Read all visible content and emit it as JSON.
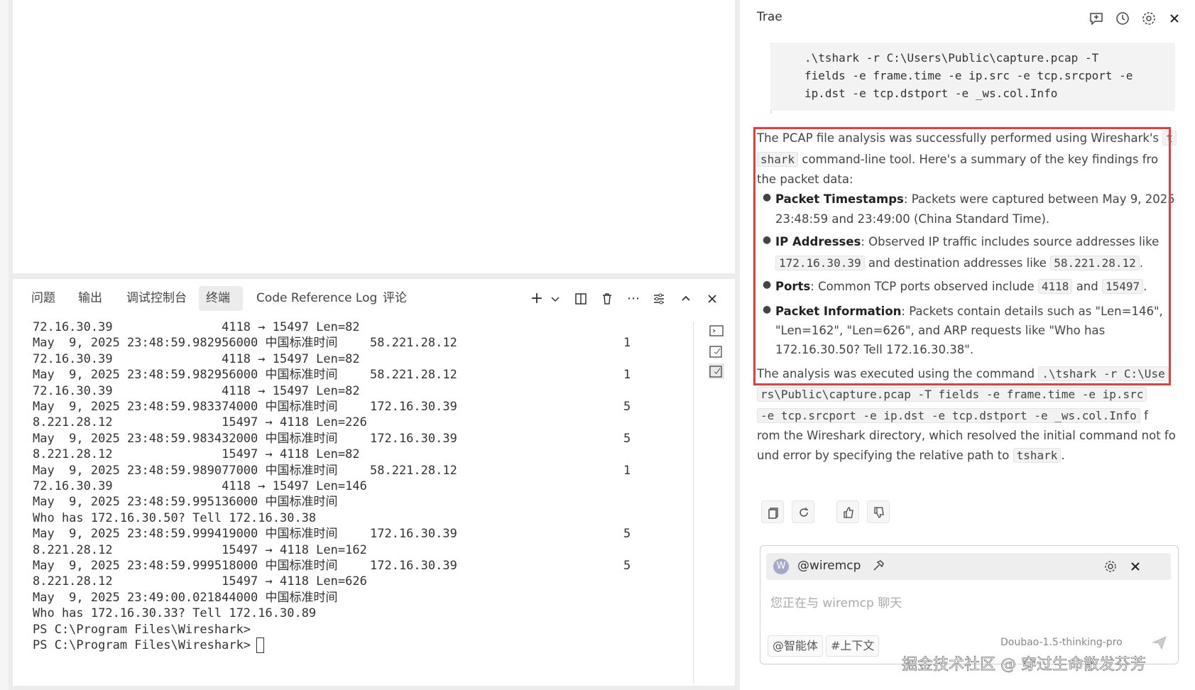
{
  "panel": {
    "tabs": [
      {
        "label": "问题"
      },
      {
        "label": "输出"
      },
      {
        "label": "调试控制台"
      },
      {
        "label": "终端"
      },
      {
        "label": "Code Reference Log"
      },
      {
        "label": "评论"
      }
    ]
  },
  "terminal": {
    "lines": [
      {
        "left": "72.16.30.39               4118 → 15497 Len=82",
        "right": "",
        "n": ""
      },
      {
        "left": "May  9, 2025 23:48:59.982956000 中国标准时间",
        "right": "58.221.28.12",
        "n": "1"
      },
      {
        "left": "72.16.30.39               4118 → 15497 Len=82",
        "right": "",
        "n": ""
      },
      {
        "left": "May  9, 2025 23:48:59.982956000 中国标准时间",
        "right": "58.221.28.12",
        "n": "1"
      },
      {
        "left": "72.16.30.39               4118 → 15497 Len=82",
        "right": "",
        "n": ""
      },
      {
        "left": "May  9, 2025 23:48:59.983374000 中国标准时间",
        "right": "172.16.30.39",
        "n": "5"
      },
      {
        "left": "8.221.28.12               15497 → 4118 Len=226",
        "right": "",
        "n": ""
      },
      {
        "left": "May  9, 2025 23:48:59.983432000 中国标准时间",
        "right": "172.16.30.39",
        "n": "5"
      },
      {
        "left": "8.221.28.12               15497 → 4118 Len=82",
        "right": "",
        "n": ""
      },
      {
        "left": "May  9, 2025 23:48:59.989077000 中国标准时间",
        "right": "58.221.28.12",
        "n": "1"
      },
      {
        "left": "72.16.30.39               4118 → 15497 Len=146",
        "right": "",
        "n": ""
      },
      {
        "left": "May  9, 2025 23:48:59.995136000 中国标准时间",
        "right": "",
        "n": ""
      },
      {
        "left": "Who has 172.16.30.50? Tell 172.16.30.38",
        "right": "",
        "n": ""
      },
      {
        "left": "May  9, 2025 23:48:59.999419000 中国标准时间",
        "right": "172.16.30.39",
        "n": "5"
      },
      {
        "left": "8.221.28.12               15497 → 4118 Len=162",
        "right": "",
        "n": ""
      },
      {
        "left": "May  9, 2025 23:48:59.999518000 中国标准时间",
        "right": "172.16.30.39",
        "n": "5"
      },
      {
        "left": "8.221.28.12               15497 → 4118 Len=626",
        "right": "",
        "n": ""
      },
      {
        "left": "May  9, 2025 23:49:00.021844000 中国标准时间",
        "right": "",
        "n": ""
      },
      {
        "left": "Who has 172.16.30.33? Tell 172.16.30.89",
        "right": "",
        "n": ""
      },
      {
        "left": "PS C:\\Program Files\\Wireshark>",
        "right": "",
        "n": ""
      }
    ],
    "prompt": "PS C:\\Program Files\\Wireshark>"
  },
  "assistant": {
    "title": "Trae",
    "code": ".\\tshark -r C:\\Users\\Public\\capture.pcap -T\nfields -e frame.time -e ip.src -e tcp.srcport -e\nip.dst -e tcp.dstport -e _ws.col.Info",
    "intro1": "The PCAP file analysis was successfully performed using Wireshark's",
    "intro_code1": "t",
    "intro_code2": "shark",
    "intro2": "command-line tool. Here's a summary of the key findings fro",
    "intro3": "the packet data:",
    "b1_title": "Packet Timestamps",
    "b1_text": ": Packets were captured between May 9, 2025",
    "b1_text2": "23:48:59 and 23:49:00 (China Standard Time).",
    "b2_title": "IP Addresses",
    "b2_text": ": Observed IP traffic includes source addresses like",
    "b2_ip1": "172.16.30.39",
    "b2_mid": "and destination addresses like",
    "b2_ip2": "58.221.28.12",
    "b2_end": ".",
    "b3_title": "Ports",
    "b3_text": ": Common TCP ports observed include",
    "b3_p1": "4118",
    "b3_and": "and",
    "b3_p2": "15497",
    "b3_end": ".",
    "b4_title": "Packet Information",
    "b4_text": ": Packets contain details such as \"Len=146\",",
    "b4_text2": "\"Len=162\", \"Len=626\", and ARP requests like \"Who has",
    "b4_text3": "172.16.30.50? Tell 172.16.30.38\".",
    "outro1": "The analysis was executed using the command",
    "outro_code1": ".\\tshark -r C:\\Use",
    "outro_code2": "rs\\Public\\capture.pcap -T fields -e frame.time -e ip.src",
    "outro_code3": "-e tcp.srcport -e ip.dst -e tcp.dstport -e _ws.col.Info",
    "outro_f": "f",
    "outro2": "rom the Wireshark directory, which resolved the initial command not fo",
    "outro3": "und error by specifying the relative path to",
    "outro_code4": "tshark",
    "outro_end": "."
  },
  "chat": {
    "agent": "@wiremcp",
    "placeholder": "您正在与 wiremcp 聊天",
    "chip_agent": "@智能体",
    "chip_context": "#上下文",
    "model": "Doubao-1.5-thinking-pro"
  },
  "watermark": "掘金技术社区 @ 穿过生命散发芬芳"
}
